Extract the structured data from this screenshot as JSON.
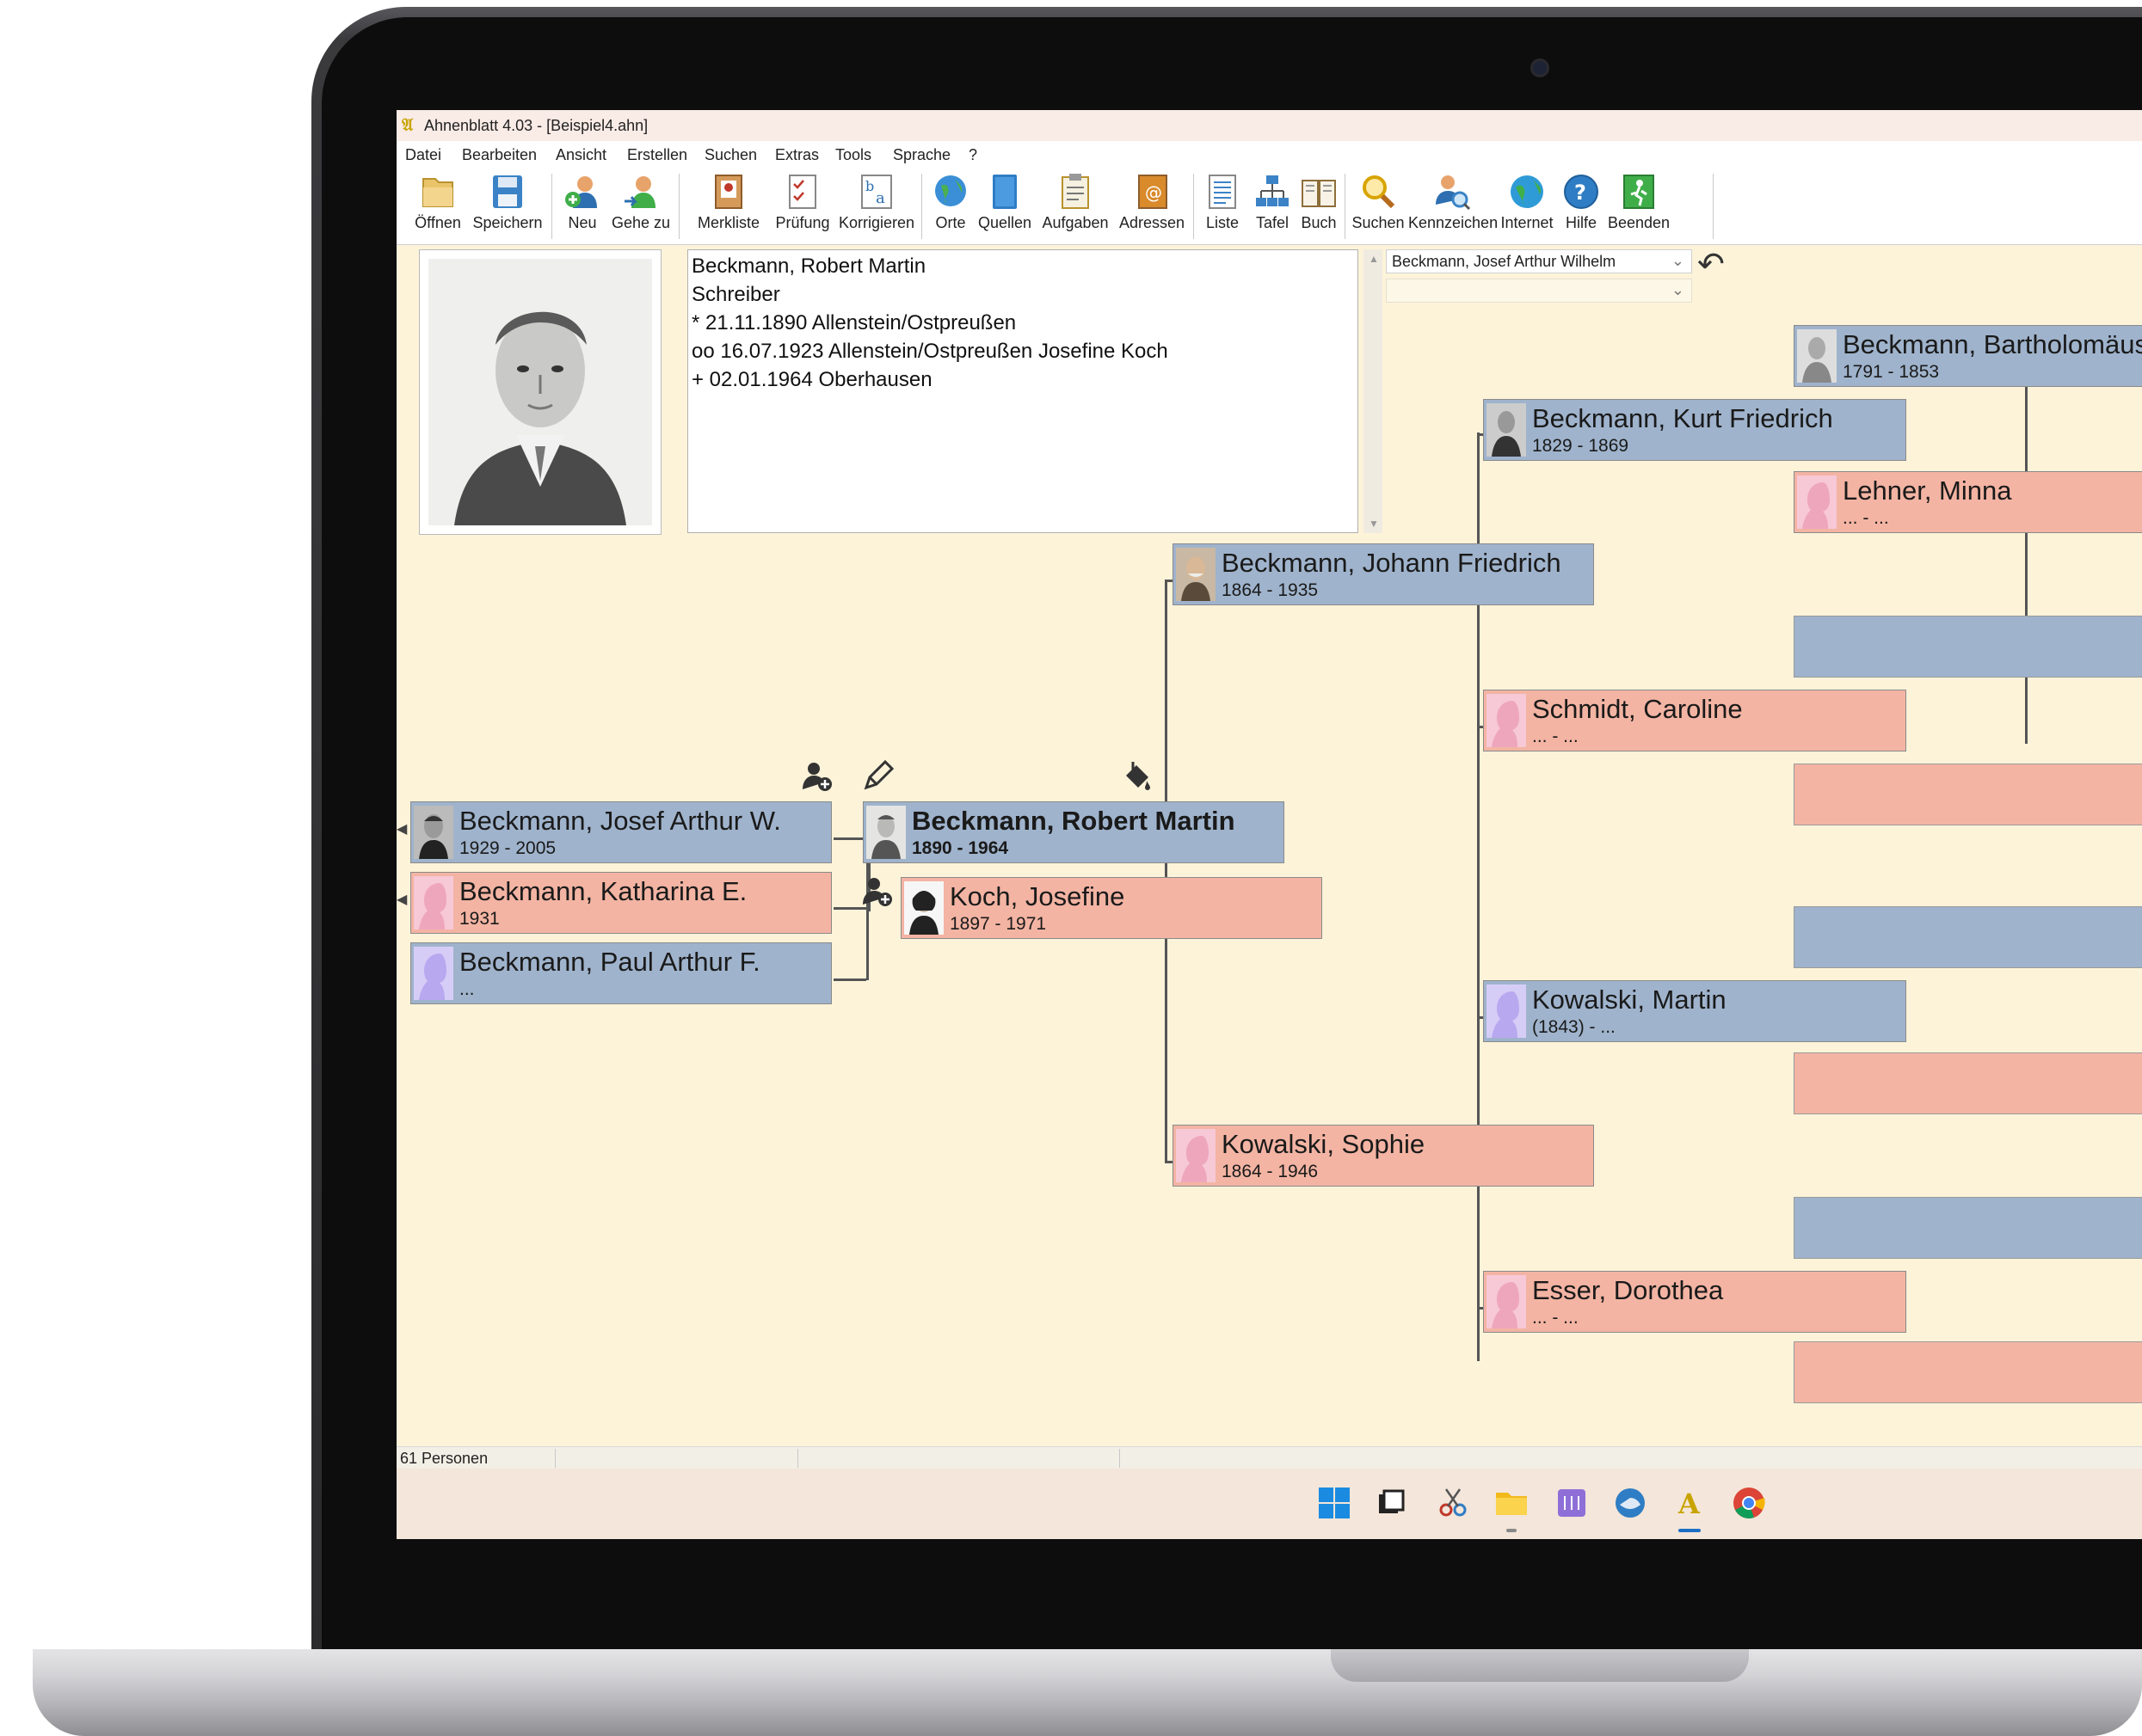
{
  "window": {
    "title": "Ahnenblatt 4.03 - [Beispiel4.ahn]",
    "app_icon": "ahnenblatt-logo-icon"
  },
  "menu": [
    "Datei",
    "Bearbeiten",
    "Ansicht",
    "Erstellen",
    "Suchen",
    "Extras",
    "Tools",
    "Sprache",
    "?"
  ],
  "toolbar": [
    {
      "label": "Öffnen",
      "icon": "folder-open-icon"
    },
    {
      "label": "Speichern",
      "icon": "save-disk-icon"
    },
    {
      "label": "Neu",
      "icon": "new-person-icon"
    },
    {
      "label": "Gehe zu",
      "icon": "goto-person-icon"
    },
    {
      "label": "Merkliste",
      "icon": "bookmark-list-icon"
    },
    {
      "label": "Prüfung",
      "icon": "check-list-icon"
    },
    {
      "label": "Korrigieren",
      "icon": "correct-text-icon"
    },
    {
      "label": "Orte",
      "icon": "globe-places-icon"
    },
    {
      "label": "Quellen",
      "icon": "book-sources-icon"
    },
    {
      "label": "Aufgaben",
      "icon": "clipboard-tasks-icon"
    },
    {
      "label": "Adressen",
      "icon": "address-book-icon"
    },
    {
      "label": "Liste",
      "icon": "list-icon"
    },
    {
      "label": "Tafel",
      "icon": "tree-chart-icon"
    },
    {
      "label": "Buch",
      "icon": "open-book-icon"
    },
    {
      "label": "Suchen",
      "icon": "magnifier-icon"
    },
    {
      "label": "Kennzeichen",
      "icon": "person-search-icon"
    },
    {
      "label": "Internet",
      "icon": "internet-globe-icon"
    },
    {
      "label": "Hilfe",
      "icon": "help-question-icon"
    },
    {
      "label": "Beenden",
      "icon": "exit-door-icon"
    }
  ],
  "info": {
    "lines": [
      "Beckmann, Robert Martin",
      "Schreiber",
      "* 21.11.1890 Allenstein/Ostpreußen",
      "oo 16.07.1923 Allenstein/Ostpreußen Josefine Koch",
      "+ 02.01.1964 Oberhausen"
    ]
  },
  "selector": {
    "person": "Beckmann, Josef Arthur Wilhelm",
    "second": ""
  },
  "persons": {
    "bartholomaeus": {
      "name": "Beckmann, Bartholomäus",
      "dates": "1791 - 1853"
    },
    "kurt": {
      "name": "Beckmann, Kurt Friedrich",
      "dates": "1829 - 1869"
    },
    "minna": {
      "name": "Lehner, Minna",
      "dates": "... - ..."
    },
    "johann": {
      "name": "Beckmann, Johann Friedrich",
      "dates": "1864 - 1935"
    },
    "caroline": {
      "name": "Schmidt, Caroline",
      "dates": "... - ..."
    },
    "josef": {
      "name": "Beckmann, Josef Arthur W.",
      "dates": "1929 - 2005"
    },
    "katharina": {
      "name": "Beckmann, Katharina E.",
      "dates": "1931"
    },
    "paul": {
      "name": "Beckmann, Paul Arthur F.",
      "dates": "..."
    },
    "robert": {
      "name": "Beckmann, Robert Martin",
      "dates": "1890 - 1964"
    },
    "josefine": {
      "name": "Koch, Josefine",
      "dates": "1897 - 1971"
    },
    "martin": {
      "name": "Kowalski, Martin",
      "dates": "(1843) - ..."
    },
    "sophie": {
      "name": "Kowalski, Sophie",
      "dates": "1864 - 1946"
    },
    "dorothea": {
      "name": "Esser, Dorothea",
      "dates": "... - ..."
    }
  },
  "status": {
    "count": "61 Personen"
  },
  "colors": {
    "male": "#9fb3cc",
    "female": "#f3b4a3",
    "background": "#fdf3d9"
  },
  "taskbar_icons": [
    "windows-start-icon",
    "task-view-icon",
    "snipping-tool-icon",
    "file-explorer-icon",
    "notepad-app-icon",
    "thunderbird-icon",
    "ahnenblatt-logo-icon",
    "chrome-icon"
  ]
}
